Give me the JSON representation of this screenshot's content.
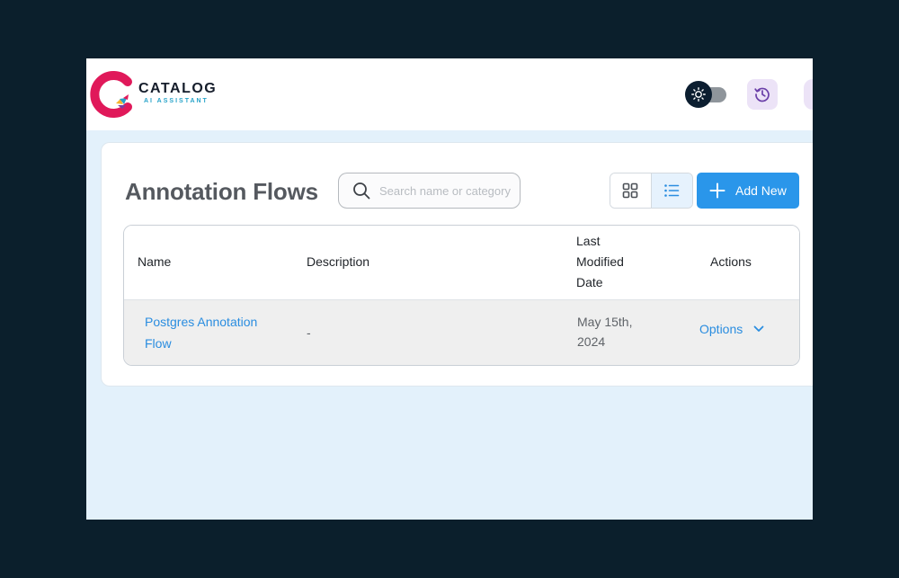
{
  "brand": {
    "name": "CATALOG",
    "tagline": "AI ASSISTANT",
    "colors": {
      "magenta": "#e0195a",
      "teal": "#26a3c9"
    }
  },
  "header": {
    "theme_toggle": {
      "icon": "sun-icon",
      "state": "light"
    },
    "history_icon": "history-icon"
  },
  "page": {
    "title": "Annotation Flows",
    "search_placeholder": "Search name or category",
    "search_value": "",
    "view_mode": "list",
    "add_button_label": "Add New"
  },
  "table": {
    "columns": {
      "name": "Name",
      "description": "Description",
      "modified_line1": "Last",
      "modified_line2": "Modified",
      "modified_line3": "Date",
      "actions": "Actions"
    },
    "rows": [
      {
        "name_line1": "Postgres Annotation",
        "name_line2": "Flow",
        "description": "-",
        "date_line1": "May 15th,",
        "date_line2": "2024",
        "action_label": "Options"
      }
    ]
  },
  "colors": {
    "accent": "#2a96ea",
    "link": "#2a8de0",
    "background": "#e3f1fb",
    "frame": "#0b1f2c"
  }
}
